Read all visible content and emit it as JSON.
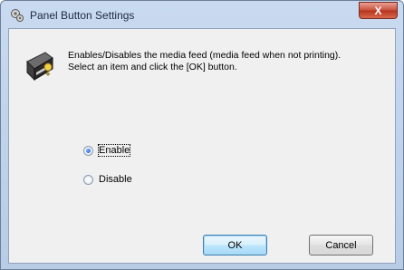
{
  "window": {
    "title": "Panel Button Settings",
    "close_label": "X"
  },
  "message": {
    "line1": "Enables/Disables the media feed (media feed when not printing).",
    "line2": "Select an item and click the [OK] button."
  },
  "options": [
    {
      "label": "Enable",
      "selected": true
    },
    {
      "label": "Disable",
      "selected": false
    }
  ],
  "buttons": {
    "ok_label": "OK",
    "cancel_label": "Cancel"
  },
  "colors": {
    "title_gradient_top": "#c9daf0",
    "client_bg": "#f0f0f0",
    "close_red": "#c8503b",
    "radio_fill": "#1b58c4"
  }
}
